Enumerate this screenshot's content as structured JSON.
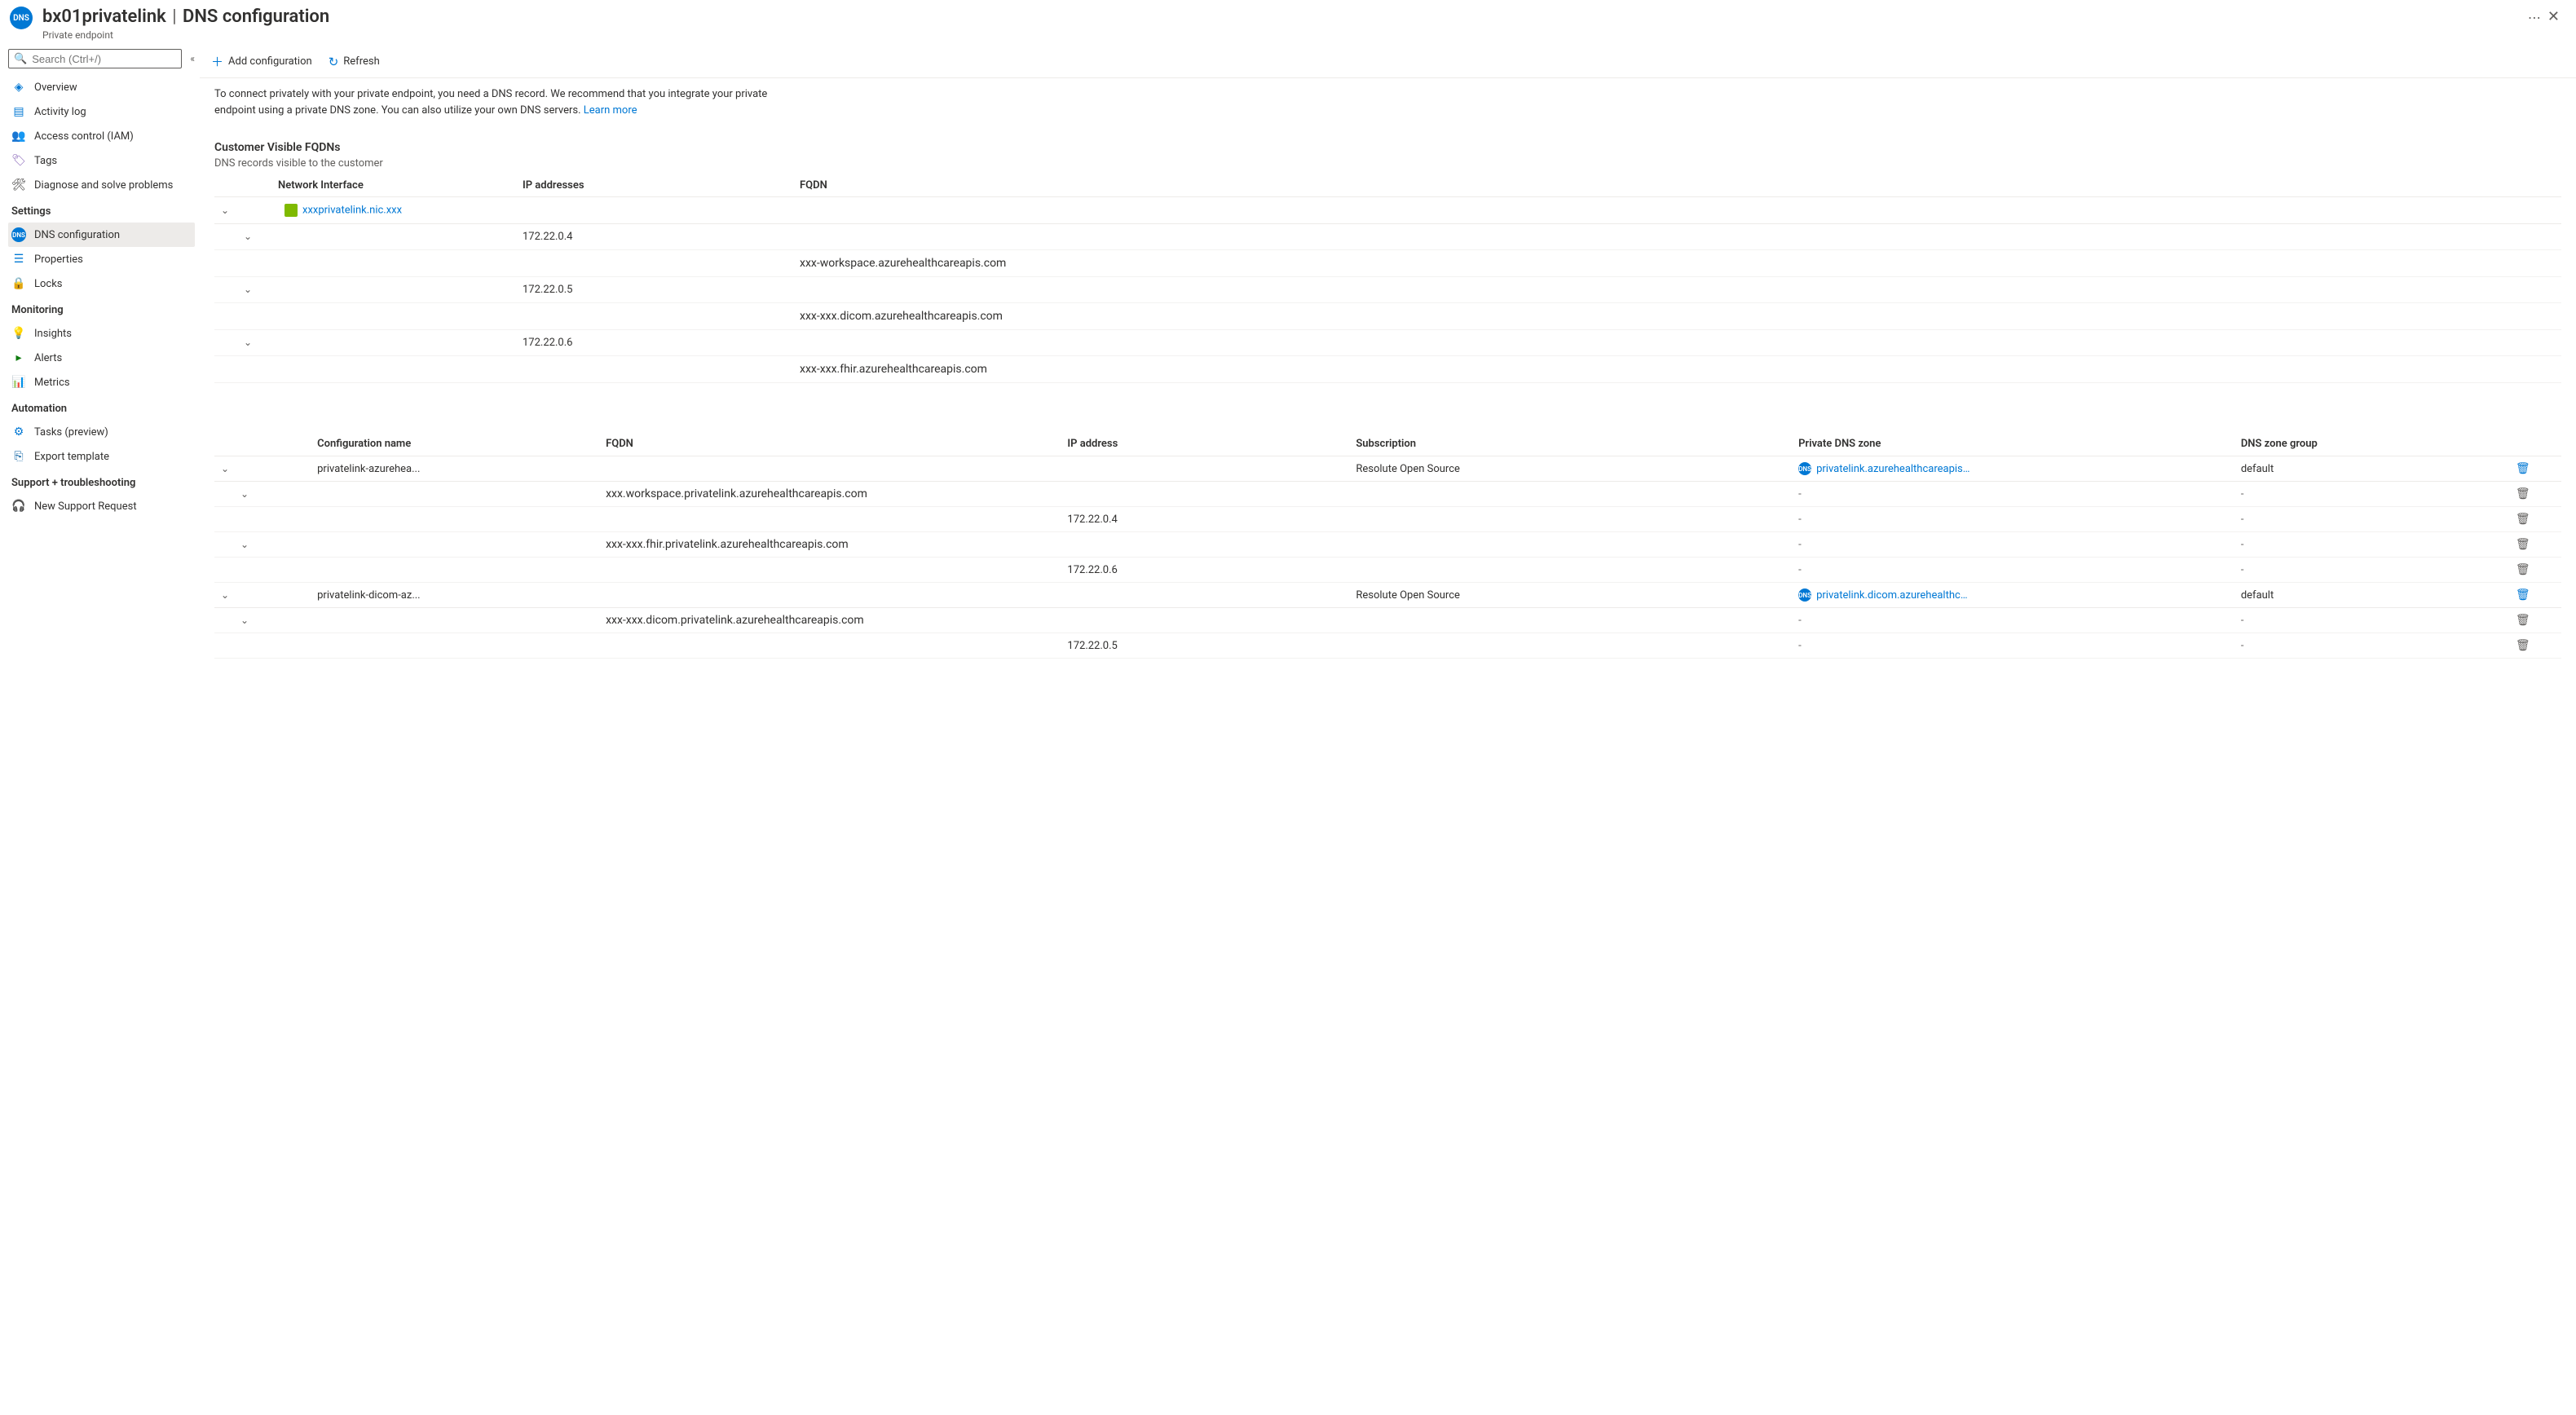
{
  "header": {
    "icon_text": "DNS",
    "resource_name": "bx01privatelink",
    "title_suffix": "DNS configuration",
    "subtitle": "Private endpoint"
  },
  "search": {
    "placeholder": "Search (Ctrl+/)"
  },
  "sidebar": {
    "groups": [
      {
        "label": null,
        "items": [
          {
            "label": "Overview",
            "icon": "overview"
          },
          {
            "label": "Activity log",
            "icon": "activity"
          },
          {
            "label": "Access control (IAM)",
            "icon": "iam"
          },
          {
            "label": "Tags",
            "icon": "tags"
          },
          {
            "label": "Diagnose and solve problems",
            "icon": "diagnose"
          }
        ]
      },
      {
        "label": "Settings",
        "items": [
          {
            "label": "DNS configuration",
            "icon": "dns",
            "active": true
          },
          {
            "label": "Properties",
            "icon": "properties"
          },
          {
            "label": "Locks",
            "icon": "locks"
          }
        ]
      },
      {
        "label": "Monitoring",
        "items": [
          {
            "label": "Insights",
            "icon": "insights"
          },
          {
            "label": "Alerts",
            "icon": "alerts"
          },
          {
            "label": "Metrics",
            "icon": "metrics"
          }
        ]
      },
      {
        "label": "Automation",
        "items": [
          {
            "label": "Tasks (preview)",
            "icon": "tasks"
          },
          {
            "label": "Export template",
            "icon": "export"
          }
        ]
      },
      {
        "label": "Support + troubleshooting",
        "items": [
          {
            "label": "New Support Request",
            "icon": "support"
          }
        ]
      }
    ]
  },
  "toolbar": {
    "add_label": "Add configuration",
    "refresh_label": "Refresh"
  },
  "intro": {
    "text": "To connect privately with your private endpoint, you need a DNS record. We recommend that you integrate your private endpoint using a private DNS zone. You can also utilize your own DNS servers. ",
    "learn_more": "Learn more"
  },
  "fqdn_section": {
    "title": "Customer Visible FQDNs",
    "subtitle": "DNS records visible to the customer",
    "headers": {
      "nic": "Network Interface",
      "ip": "IP addresses",
      "fqdn": "FQDN"
    },
    "nic_link": "xxxprivatelink.nic.xxx",
    "rows": [
      {
        "ip": "172.22.0.4",
        "fqdn": "xxx-workspace.azurehealthcareapis.com"
      },
      {
        "ip": "172.22.0.5",
        "fqdn": "xxx-xxx.dicom.azurehealthcareapis.com"
      },
      {
        "ip": "172.22.0.6",
        "fqdn": "xxx-xxx.fhir.azurehealthcareapis.com"
      }
    ]
  },
  "config_section": {
    "headers": {
      "name": "Configuration name",
      "fqdn": "FQDN",
      "ip": "IP address",
      "sub": "Subscription",
      "zone": "Private DNS zone",
      "group": "DNS zone group"
    },
    "groups": [
      {
        "name": "privatelink-azurehea...",
        "subscription": "Resolute Open Source",
        "zone": "privatelink.azurehealthcareapis.com",
        "group": "default",
        "rows": [
          {
            "fqdn": "xxx.workspace.privatelink.azurehealthcareapis.com",
            "ip": ""
          },
          {
            "fqdn": "",
            "ip": "172.22.0.4"
          },
          {
            "fqdn": "xxx-xxx.fhir.privatelink.azurehealthcareapis.com",
            "ip": ""
          },
          {
            "fqdn": "",
            "ip": "172.22.0.6"
          }
        ]
      },
      {
        "name": "privatelink-dicom-az...",
        "subscription": "Resolute Open Source",
        "zone": "privatelink.dicom.azurehealthcarea...",
        "group": "default",
        "rows": [
          {
            "fqdn": "xxx-xxx.dicom.privatelink.azurehealthcareapis.com",
            "ip": ""
          },
          {
            "fqdn": "",
            "ip": "172.22.0.5"
          }
        ]
      }
    ]
  },
  "dash": "-"
}
